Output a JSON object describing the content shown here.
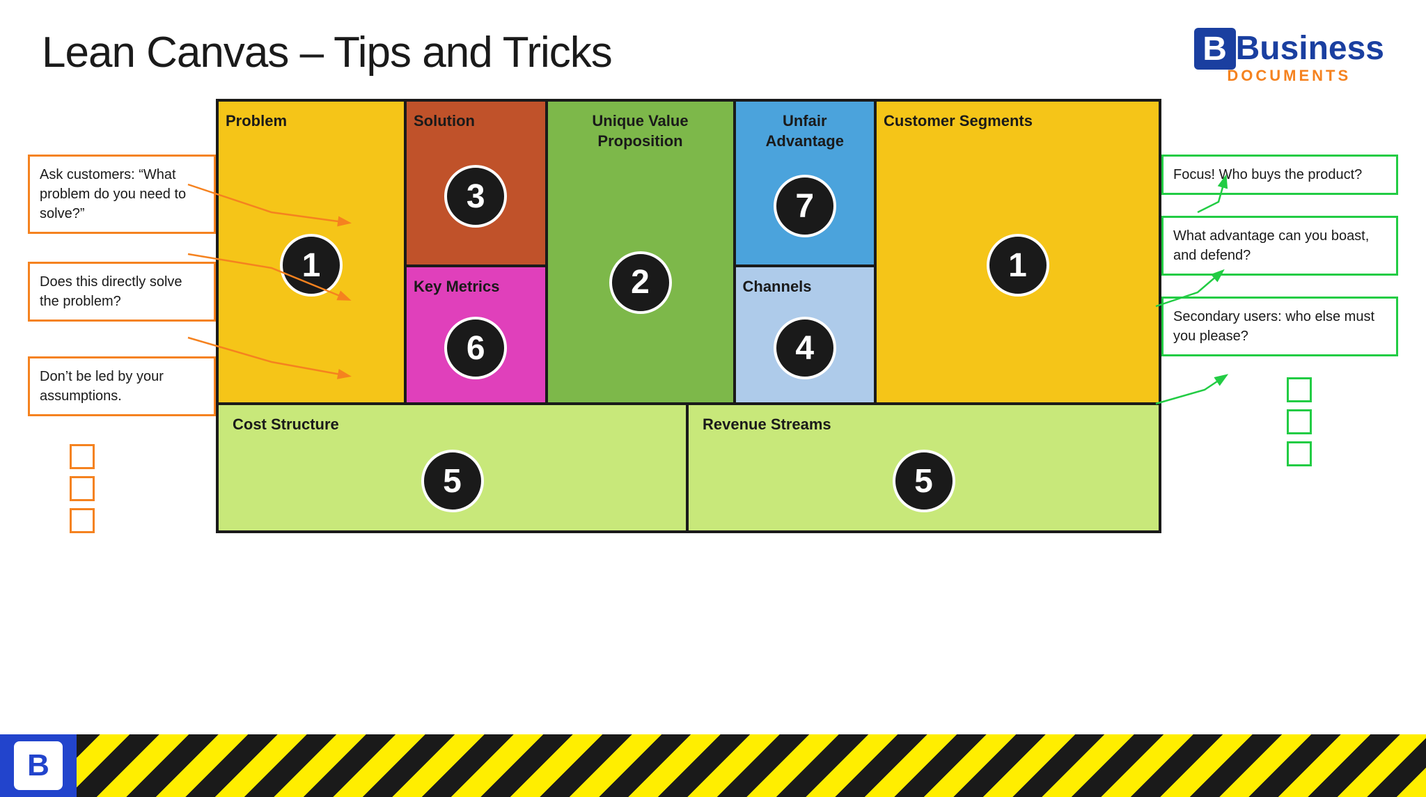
{
  "header": {
    "title": "Lean Canvas – Tips and Tricks",
    "logo": {
      "letter": "B",
      "business": "Business",
      "documents": "DOCUMENTS"
    }
  },
  "canvas": {
    "cells": {
      "problem": {
        "title": "Problem",
        "number": "1"
      },
      "solution": {
        "title": "Solution",
        "number": "3"
      },
      "uvp": {
        "title": "Unique Value Proposition",
        "number": "2"
      },
      "unfair": {
        "title": "Unfair Advantage",
        "number": "7"
      },
      "customer": {
        "title": "Customer Segments",
        "number": "1"
      },
      "key_metrics": {
        "title": "Key Metrics",
        "number": "6"
      },
      "channels": {
        "title": "Channels",
        "number": "4"
      },
      "cost": {
        "title": "Cost Structure",
        "number": "5"
      },
      "revenue": {
        "title": "Revenue Streams",
        "number": "5"
      }
    }
  },
  "left_annotations": [
    {
      "text": "Ask customers: “What problem do you need to solve?”"
    },
    {
      "text": "Does this directly solve the problem?"
    },
    {
      "text": "Don’t be led by your assumptions."
    }
  ],
  "right_annotations": [
    {
      "text": "Focus! Who buys the product?"
    },
    {
      "text": "What advantage can you boast, and defend?"
    },
    {
      "text": "Secondary users: who else must you please?"
    }
  ],
  "colors": {
    "orange_border": "#f5821f",
    "green_border": "#22cc44",
    "problem_bg": "#f5c518",
    "solution_bg": "#c0522a",
    "uvp_bg": "#7db84a",
    "unfair_bg": "#4ba3dc",
    "customer_bg": "#f5c518",
    "key_metrics_bg": "#e040bb",
    "channels_bg": "#aecbea",
    "cost_bg": "#c8e87a",
    "revenue_bg": "#c8e87a",
    "footer_blue": "#2244cc",
    "stripe_yellow": "#ffee00"
  }
}
